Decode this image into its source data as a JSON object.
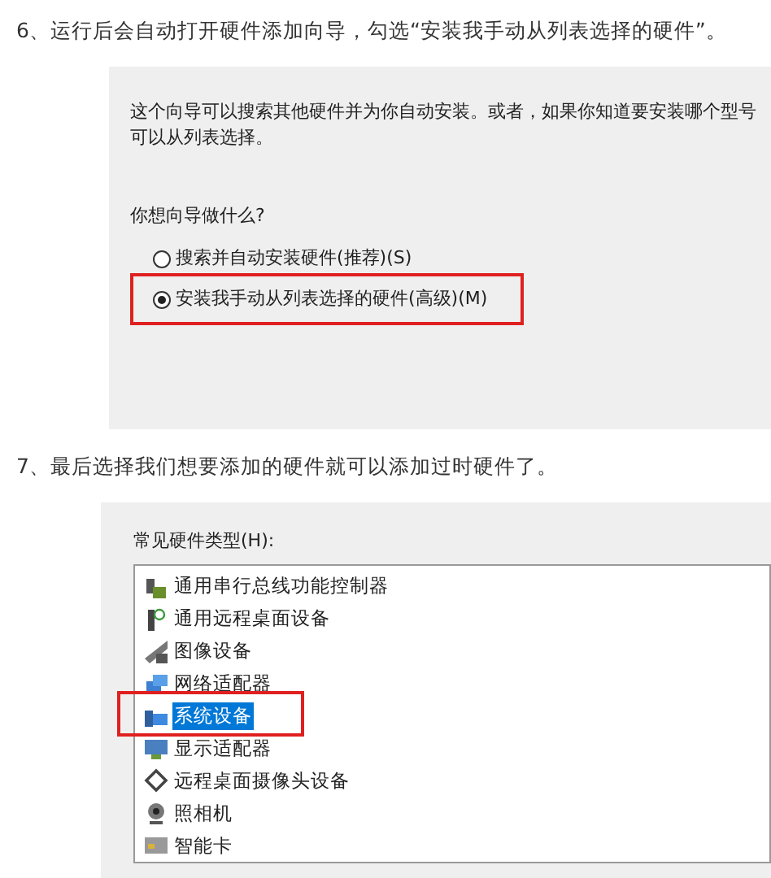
{
  "steps": [
    {
      "text": "6、运行后会自动打开硬件添加向导，勾选“安装我手动从列表选择的硬件”。",
      "kind": "wizard",
      "wizard": {
        "intro": [
          "这个向导可以搜索其他硬件并为你自动安装。或者，如果你知道要安装哪个型号",
          "可以从列表选择。"
        ],
        "question": "你想向导做什么?",
        "options": [
          {
            "label": "搜索并自动安装硬件(推荐)(S)",
            "selected": false,
            "highlighted": false
          },
          {
            "label": "安装我手动从列表选择的硬件(高级)(M)",
            "selected": true,
            "highlighted": true
          }
        ]
      }
    },
    {
      "text": "7、最后选择我们想要添加的硬件就可以添加过时硬件了。",
      "kind": "list",
      "list": {
        "label": "常见硬件类型(H):",
        "items": [
          {
            "label": "通用串行总线功能控制器",
            "selected": false,
            "highlighted": false
          },
          {
            "label": "通用远程桌面设备",
            "selected": false,
            "highlighted": false
          },
          {
            "label": "图像设备",
            "selected": false,
            "highlighted": false
          },
          {
            "label": "网络适配器",
            "selected": false,
            "highlighted": false
          },
          {
            "label": "系统设备",
            "selected": true,
            "highlighted": true
          },
          {
            "label": "显示适配器",
            "selected": false,
            "highlighted": false
          },
          {
            "label": "远程桌面摄像头设备",
            "selected": false,
            "highlighted": false
          },
          {
            "label": "照相机",
            "selected": false,
            "highlighted": false
          },
          {
            "label": "智能卡",
            "selected": false,
            "highlighted": false
          }
        ]
      }
    }
  ]
}
